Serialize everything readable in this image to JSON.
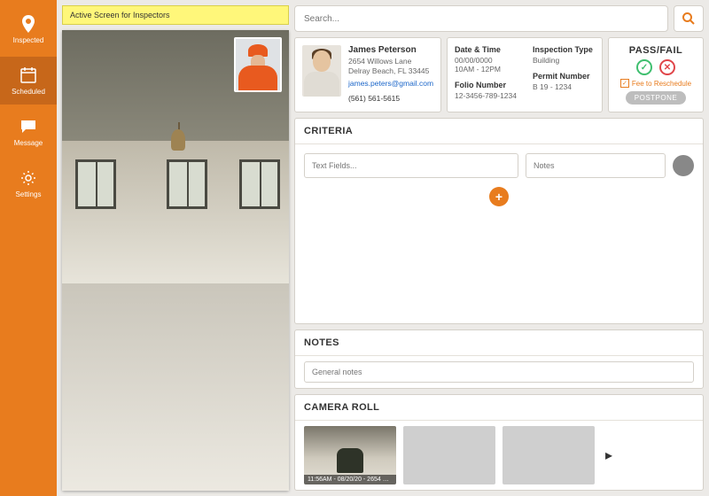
{
  "sidebar": {
    "items": [
      {
        "label": "Inspected",
        "icon": "pin-icon"
      },
      {
        "label": "Scheduled",
        "icon": "calendar-icon"
      },
      {
        "label": "Message",
        "icon": "message-icon"
      },
      {
        "label": "Settings",
        "icon": "gear-icon"
      }
    ],
    "active_index": 1
  },
  "banner": "Active Screen for Inspectors",
  "search": {
    "placeholder": "Search..."
  },
  "person": {
    "name": "James Peterson",
    "address_line1": "2654 Willows Lane",
    "address_line2": "Delray Beach, FL 33445",
    "email": "james.peters@gmail.com",
    "phone": "(561) 561-5615"
  },
  "meta": {
    "date_label": "Date & Time",
    "date_value": "00/00/0000",
    "time_value": "10AM - 12PM",
    "folio_label": "Folio Number",
    "folio_value": "12-3456-789-1234",
    "type_label": "Inspection Type",
    "type_value": "Building",
    "permit_label": "Permit Number",
    "permit_value": "B 19 - 1234"
  },
  "passfail": {
    "title": "PASS/FAIL",
    "fee_label": "Fee to Reschedule",
    "fee_checked": true,
    "postpone_label": "POSTPONE"
  },
  "criteria": {
    "header": "CRITERIA",
    "text_placeholder": "Text Fields...",
    "notes_placeholder": "Notes"
  },
  "notes": {
    "header": "NOTES",
    "placeholder": "General notes"
  },
  "camera": {
    "header": "CAMERA ROLL",
    "items": [
      {
        "caption": "11:56AM - 08/20/20 - 2654 Willows Lane..."
      },
      {
        "caption": ""
      },
      {
        "caption": ""
      }
    ]
  },
  "colors": {
    "accent": "#e87c1e"
  }
}
